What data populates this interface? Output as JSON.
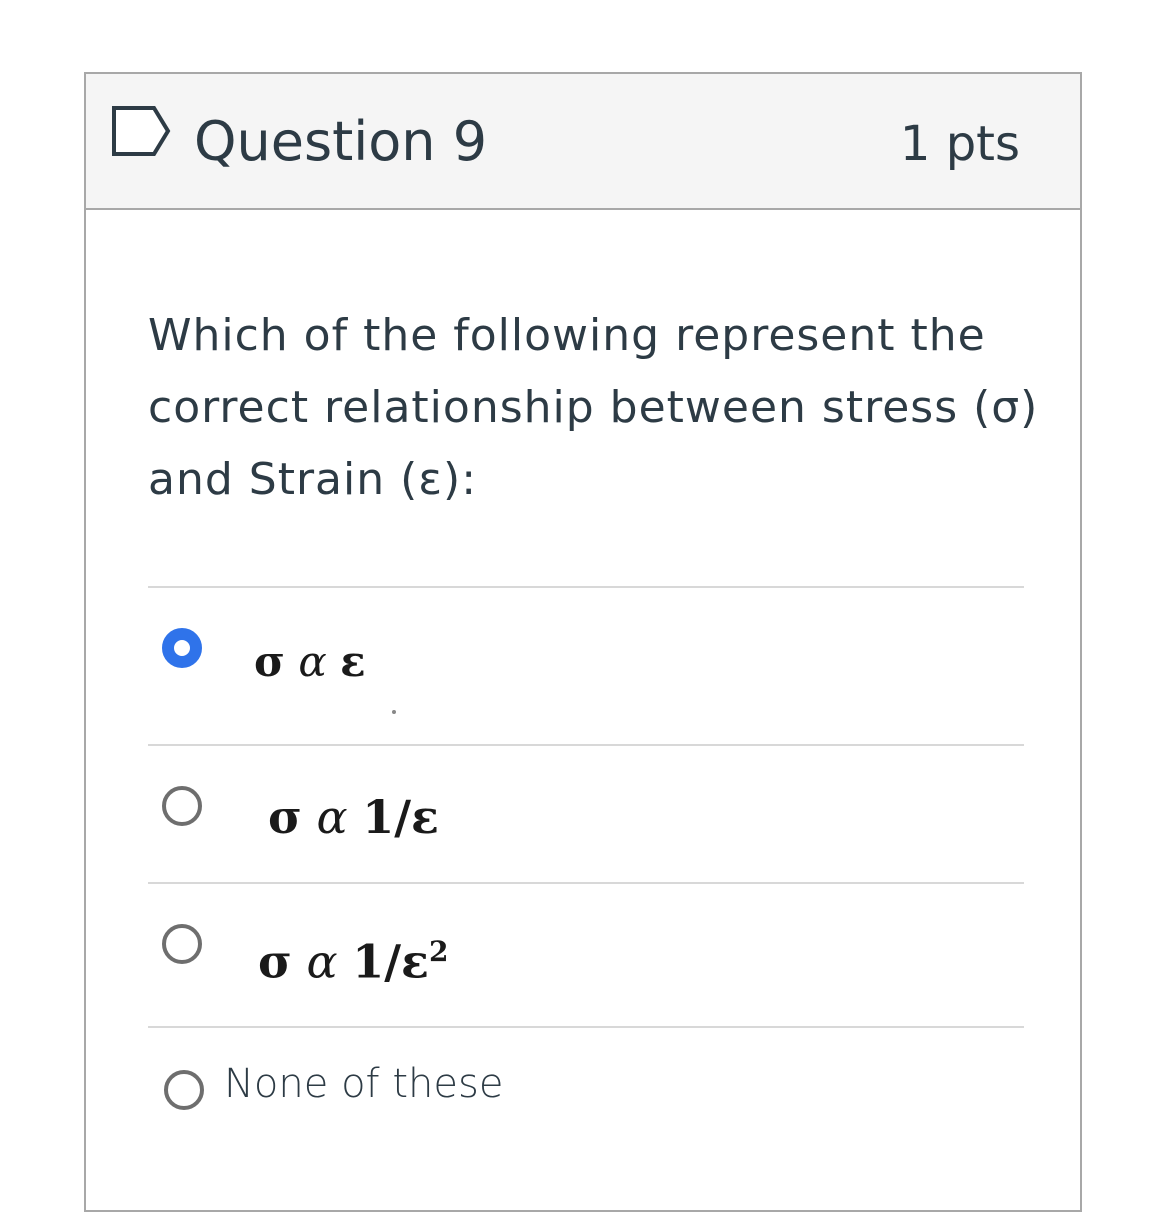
{
  "question": {
    "title": "Question 9",
    "points": "1 pts",
    "text": "Which of the following represent the correct relationship between stress (σ) and Strain (ε):",
    "flag_icon": "flag-outline-icon"
  },
  "answers": [
    {
      "selected": true,
      "sigma": "σ",
      "alpha": "α",
      "rhs": "ε",
      "superscript": ""
    },
    {
      "selected": false,
      "sigma": "σ",
      "alpha": "α",
      "rhs": "1/ε",
      "superscript": ""
    },
    {
      "selected": false,
      "sigma": "σ",
      "alpha": "α",
      "rhs": "1/ε",
      "superscript": "2"
    },
    {
      "selected": false,
      "label": "None of these"
    }
  ],
  "colors": {
    "selected_radio": "#2f73ea",
    "header_bg": "#f5f5f5",
    "text": "#2d3b45"
  }
}
